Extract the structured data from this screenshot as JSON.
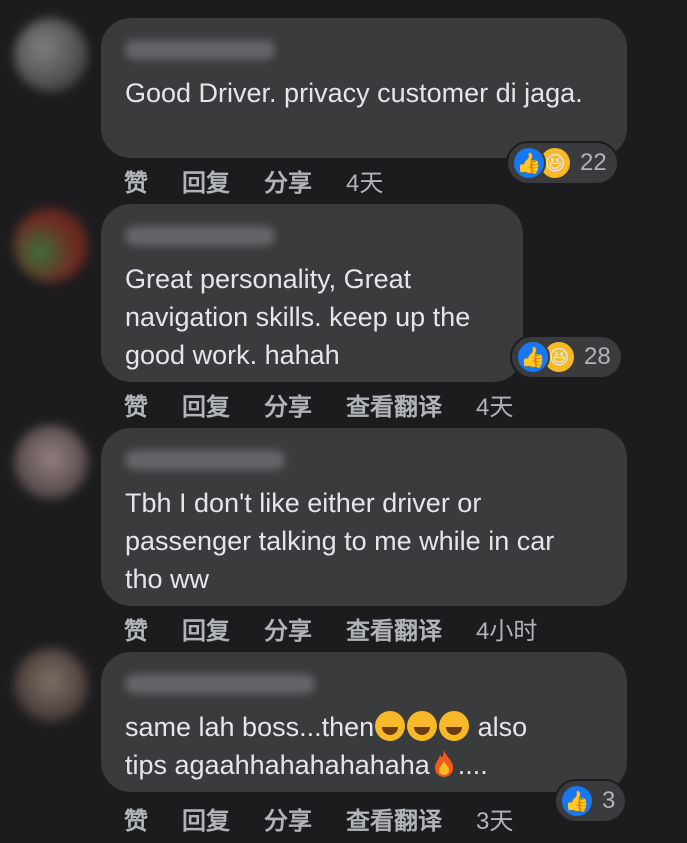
{
  "comments": [
    {
      "text": "Good Driver. privacy customer di jaga.",
      "actions": {
        "like": "赞",
        "reply": "回复",
        "share": "分享",
        "time": "4天"
      },
      "reaction_count": "22",
      "reactions": [
        "like-icon",
        "haha-icon"
      ]
    },
    {
      "text": "Great personality, Great navigation skills. keep up the good work. hahah",
      "actions": {
        "like": "赞",
        "reply": "回复",
        "share": "分享",
        "translate": "查看翻译",
        "time": "4天"
      },
      "reaction_count": "28",
      "reactions": [
        "like-icon",
        "haha-icon"
      ]
    },
    {
      "text": "Tbh I don't like either driver or passenger talking to me while in car tho ww",
      "actions": {
        "like": "赞",
        "reply": "回复",
        "share": "分享",
        "translate": "查看翻译",
        "time": "4小时"
      }
    },
    {
      "text_part1": "same lah boss...then",
      "text_part2": " also",
      "text_part3": "tips agaahhahahahahaha",
      "text_part4": "....",
      "actions": {
        "like": "赞",
        "reply": "回复",
        "share": "分享",
        "translate": "查看翻译",
        "time": "3天"
      },
      "reaction_count": "3",
      "reactions": [
        "like-icon"
      ]
    }
  ],
  "colors": {
    "background": "#1c1c1e",
    "bubble": "#3a3b3d",
    "like": "#1877f2",
    "haha": "#f7b928"
  }
}
